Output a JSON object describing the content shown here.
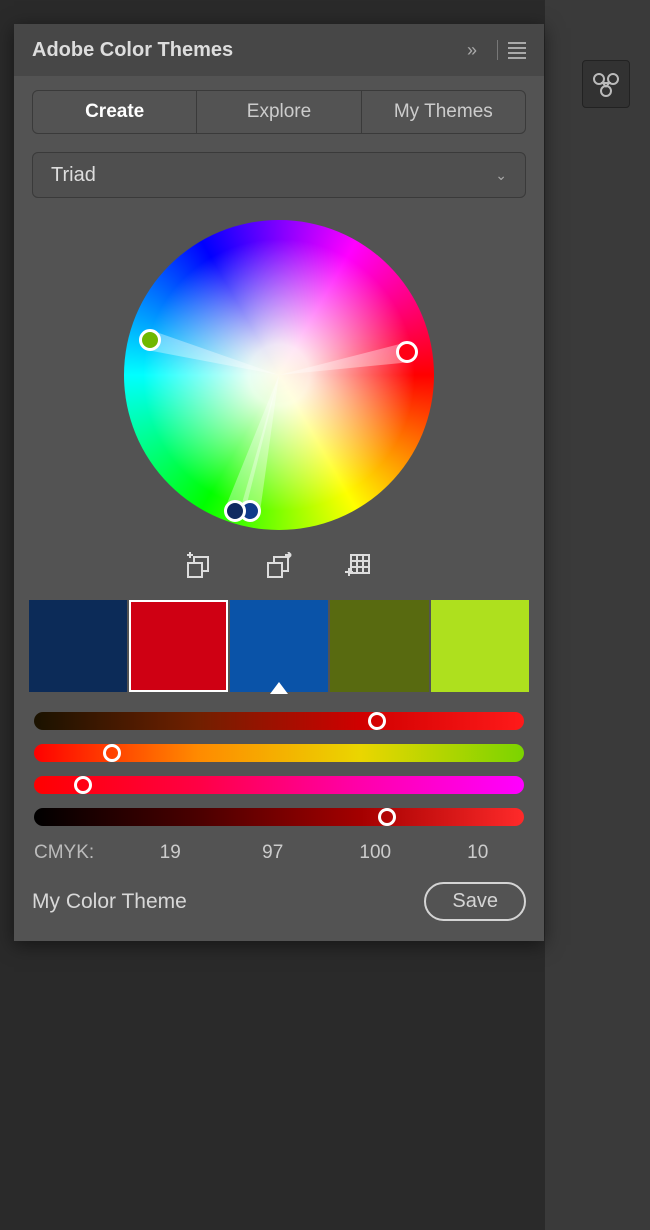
{
  "panel": {
    "title": "Adobe Color Themes",
    "tabs": [
      "Create",
      "Explore",
      "My Themes"
    ],
    "active_tab_index": 0,
    "harmony_rule": "Triad",
    "theme_name": "My Color Theme",
    "save_label": "Save"
  },
  "wheel": {
    "points": [
      {
        "angle_deg": 195,
        "radius_pct": 86,
        "color": "#6fb800",
        "selected": false
      },
      {
        "angle_deg": 350,
        "radius_pct": 84,
        "color": "#ff0015",
        "selected": true
      },
      {
        "angle_deg": 102,
        "radius_pct": 90,
        "color": "#0f3a8a",
        "selected": false
      },
      {
        "angle_deg": 108,
        "radius_pct": 92,
        "color": "#102a60",
        "selected": false
      }
    ]
  },
  "swatches": [
    {
      "color": "#0c2b58",
      "selected": false,
      "base": false
    },
    {
      "color": "#cf0013",
      "selected": true,
      "base": false
    },
    {
      "color": "#0a53a8",
      "selected": false,
      "base": true
    },
    {
      "color": "#586a10",
      "selected": false,
      "base": false
    },
    {
      "color": "#aee01e",
      "selected": false,
      "base": false
    }
  ],
  "sliders": [
    {
      "pos_pct": 70,
      "stops": [
        "#1a1200",
        "#702000",
        "#d00000",
        "#ff1a1a"
      ]
    },
    {
      "pos_pct": 16,
      "stops": [
        "#ff0000",
        "#ff8a00",
        "#ead600",
        "#7bd400"
      ]
    },
    {
      "pos_pct": 10,
      "stops": [
        "#ff0000",
        "#ff0044",
        "#ff00aa",
        "#ff00ff"
      ]
    },
    {
      "pos_pct": 72,
      "stops": [
        "#000000",
        "#4a0000",
        "#a40000",
        "#ff2a2a"
      ]
    }
  ],
  "cmyk": {
    "label": "CMYK:",
    "c": "19",
    "m": "97",
    "y": "100",
    "k": "10"
  }
}
